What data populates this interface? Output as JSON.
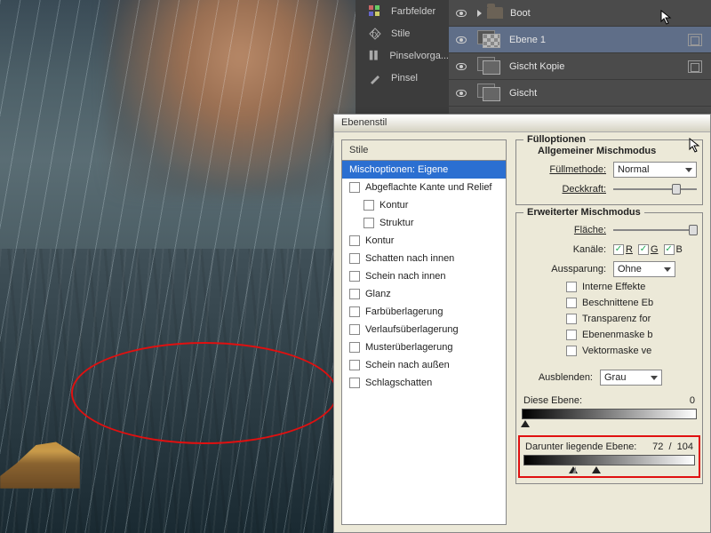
{
  "panels": {
    "swatches": "Farbfelder",
    "styles": "Stile",
    "brush_presets": "Pinselvorga...",
    "brush": "Pinsel"
  },
  "layers": {
    "items": [
      {
        "name": "Boot",
        "type": "folder"
      },
      {
        "name": "Ebene 1",
        "type": "layer",
        "selected": true
      },
      {
        "name": "Gischt Kopie",
        "type": "layer"
      },
      {
        "name": "Gischt",
        "type": "layer"
      }
    ]
  },
  "dialog": {
    "title": "Ebenenstil",
    "styles_header": "Stile",
    "style_items": [
      {
        "label": "Mischoptionen: Eigene",
        "selected": true,
        "checkbox": false
      },
      {
        "label": "Abgeflachte Kante und Relief",
        "checkbox": true
      },
      {
        "label": "Kontur",
        "checkbox": true,
        "child": true
      },
      {
        "label": "Struktur",
        "checkbox": true,
        "child": true
      },
      {
        "label": "Kontur",
        "checkbox": true
      },
      {
        "label": "Schatten nach innen",
        "checkbox": true
      },
      {
        "label": "Schein nach innen",
        "checkbox": true
      },
      {
        "label": "Glanz",
        "checkbox": true
      },
      {
        "label": "Farbüberlagerung",
        "checkbox": true
      },
      {
        "label": "Verlaufsüberlagerung",
        "checkbox": true
      },
      {
        "label": "Musterüberlagerung",
        "checkbox": true
      },
      {
        "label": "Schein nach außen",
        "checkbox": true
      },
      {
        "label": "Schlagschatten",
        "checkbox": true
      }
    ],
    "fill_options": {
      "title": "Fülloptionen",
      "subtitle": "Allgemeiner Mischmodus",
      "blend_mode_label": "Füllmethode:",
      "blend_mode_value": "Normal",
      "opacity_label": "Deckkraft:"
    },
    "advanced": {
      "title": "Erweiterter Mischmodus",
      "fill_label": "Fläche:",
      "channels_label": "Kanäle:",
      "channels": {
        "r": "R",
        "g": "G",
        "b": "B"
      },
      "knockout_label": "Aussparung:",
      "knockout_value": "Ohne",
      "check_internal": "Interne Effekte",
      "check_clipped": "Beschnittene Eb",
      "check_transp": "Transparenz for",
      "check_mask": "Ebenenmaske b",
      "check_vector": "Vektormaske ve"
    },
    "blend_if": {
      "label": "Ausblenden:",
      "value": "Grau",
      "this_layer_label": "Diese Ebene:",
      "this_layer_val": "0",
      "under_label": "Darunter liegende Ebene:",
      "under_lo": "72",
      "under_sep": "/",
      "under_hi": "104"
    }
  }
}
